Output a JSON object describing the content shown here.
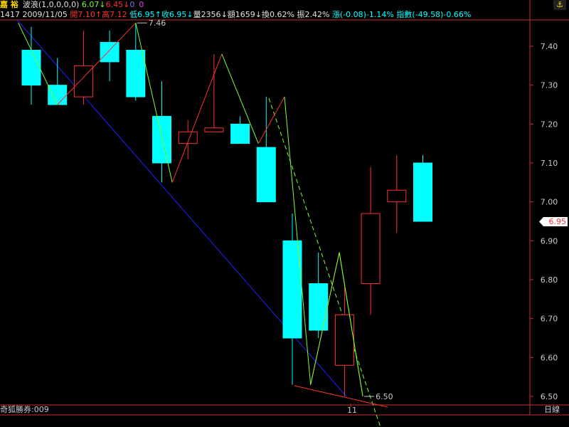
{
  "header": {
    "stock_name": "嘉  裕",
    "indicator": "波浪(1,0,0,0,0)",
    "wave_v1": "6.07",
    "wave_v2": "6.45",
    "wave_v3": "0",
    "wave_v4": "0",
    "code": "1417",
    "date": "2009/11/05",
    "open_label": "開",
    "open": "7.10",
    "high_label": "高",
    "high": "7.12",
    "low_label": "低",
    "low": "6.95",
    "close_label": "收",
    "close": "6.95",
    "volume_label": "量",
    "volume": "2356",
    "amount_label": "額",
    "amount": "1659",
    "turnover_label": "換",
    "turnover": "0.62%",
    "amplitude_label": "振",
    "amplitude": "2.42%",
    "change_label": "漲",
    "change": "(-0.08)-1.14%",
    "index_label": "指數",
    "index_change": "(-49.58)-0.66%"
  },
  "footer": {
    "broker": "奇狐勝券:009",
    "period": "日線",
    "date_tick": "11"
  },
  "annotations": {
    "high_mark": "7.46",
    "low_mark": "6.50",
    "last_price": "6.95"
  },
  "colors": {
    "up": "#ff3030",
    "down": "#00ffff",
    "wave_green": "#7cff2a",
    "wave_red": "#ff3030",
    "trend_blue": "#2020ff",
    "axis": "#c83232",
    "label": "#c8c8c8"
  },
  "chart_data": {
    "type": "candlestick",
    "ylim": [
      6.47,
      7.58
    ],
    "y_ticks": [
      7.4,
      7.3,
      7.2,
      7.1,
      7.0,
      6.9,
      6.8,
      6.7,
      6.6,
      6.5
    ],
    "candles": [
      {
        "open": 7.39,
        "close": 7.3,
        "high": 7.45,
        "low": 7.25
      },
      {
        "open": 7.3,
        "close": 7.25,
        "high": 7.37,
        "low": 7.25
      },
      {
        "open": 7.27,
        "close": 7.35,
        "high": 7.44,
        "low": 7.25
      },
      {
        "open": 7.41,
        "close": 7.36,
        "high": 7.44,
        "low": 7.31
      },
      {
        "open": 7.39,
        "close": 7.27,
        "high": 7.46,
        "low": 7.26
      },
      {
        "open": 7.22,
        "close": 7.1,
        "high": 7.31,
        "low": 7.05
      },
      {
        "open": 7.15,
        "close": 7.18,
        "high": 7.21,
        "low": 7.11
      },
      {
        "open": 7.18,
        "close": 7.19,
        "high": 7.38,
        "low": 7.18
      },
      {
        "open": 7.2,
        "close": 7.15,
        "high": 7.22,
        "low": 7.15
      },
      {
        "open": 7.14,
        "close": 7.0,
        "high": 7.27,
        "low": 7.0
      },
      {
        "open": 6.9,
        "close": 6.65,
        "high": 6.97,
        "low": 6.53
      },
      {
        "open": 6.79,
        "close": 6.67,
        "high": 6.87,
        "low": 6.65
      },
      {
        "open": 6.58,
        "close": 6.71,
        "high": 6.78,
        "low": 6.5
      },
      {
        "open": 6.79,
        "close": 6.97,
        "high": 7.09,
        "low": 6.71
      },
      {
        "open": 7.0,
        "close": 7.03,
        "high": 7.12,
        "low": 6.92
      },
      {
        "open": 7.1,
        "close": 6.95,
        "high": 7.12,
        "low": 6.95
      }
    ],
    "wave_points": [
      {
        "i": -0.5,
        "v": 7.46
      },
      {
        "i": 1,
        "v": 7.25
      },
      {
        "i": 4,
        "v": 7.46
      },
      {
        "i": 5.4,
        "v": 7.05
      },
      {
        "i": 7.3,
        "v": 7.38
      },
      {
        "i": 8.7,
        "v": 7.15
      },
      {
        "i": 9.7,
        "v": 7.27
      },
      {
        "i": 10.7,
        "v": 6.53
      },
      {
        "i": 11.8,
        "v": 6.87
      },
      {
        "i": 12.7,
        "v": 6.5
      }
    ]
  }
}
